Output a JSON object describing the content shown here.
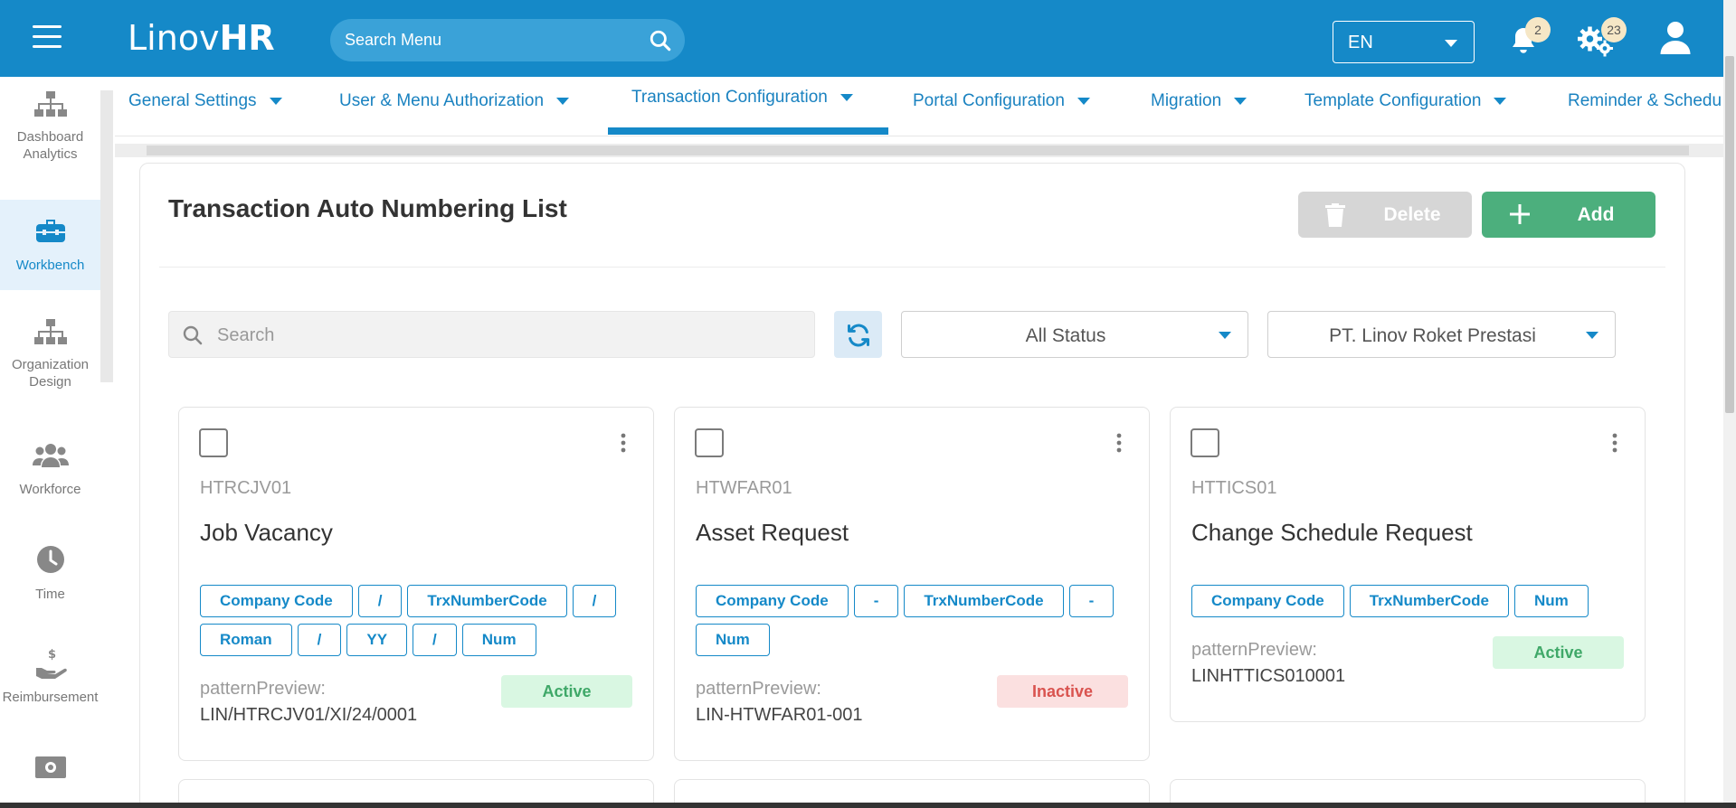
{
  "header": {
    "logo_part1": "Linov",
    "logo_part2": "HR",
    "search_placeholder": "Search Menu",
    "language": "EN",
    "notifications_count": "2",
    "settings_count": "23",
    "accent_color": "#1589c8"
  },
  "sidebar": {
    "items": [
      {
        "label_line1": "Dashboard",
        "label_line2": "Analytics",
        "icon": "sitemap-icon",
        "active": false
      },
      {
        "label_line1": "Workbench",
        "label_line2": "",
        "icon": "toolbox-icon",
        "active": true
      },
      {
        "label_line1": "Organization",
        "label_line2": "Design",
        "icon": "sitemap-icon",
        "active": false
      },
      {
        "label_line1": "Workforce",
        "label_line2": "",
        "icon": "users-icon",
        "active": false
      },
      {
        "label_line1": "Time",
        "label_line2": "",
        "icon": "clock-icon",
        "active": false
      },
      {
        "label_line1": "Reimbursement",
        "label_line2": "",
        "icon": "hand-dollar-icon",
        "active": false
      },
      {
        "label_line1": "",
        "label_line2": "",
        "icon": "money-icon",
        "active": false
      }
    ]
  },
  "tabs": [
    {
      "label": "General Settings"
    },
    {
      "label": "User & Menu Authorization"
    },
    {
      "label": "Transaction Configuration",
      "active": true
    },
    {
      "label": "Portal Configuration"
    },
    {
      "label": "Migration"
    },
    {
      "label": "Template Configuration"
    },
    {
      "label": "Reminder & Schedu"
    }
  ],
  "page": {
    "title": "Transaction Auto Numbering List",
    "delete_label": "Delete",
    "add_label": "Add",
    "search_placeholder": "Search",
    "status_filter": "All Status",
    "company_filter": "PT. Linov Roket Prestasi"
  },
  "cards": [
    {
      "code": "HTRCJV01",
      "title": "Job Vacancy",
      "chips": [
        "Company Code",
        "/",
        "TrxNumberCode",
        "/",
        "Roman",
        "/",
        "YY",
        "/",
        "Num"
      ],
      "pattern_label": "patternPreview:",
      "pattern_value": "LIN/HTRCJV01/XI/24/0001",
      "status": "Active"
    },
    {
      "code": "HTWFAR01",
      "title": "Asset Request",
      "chips": [
        "Company Code",
        "-",
        "TrxNumberCode",
        "-",
        "Num"
      ],
      "pattern_label": "patternPreview:",
      "pattern_value": "LIN-HTWFAR01-001",
      "status": "Inactive"
    },
    {
      "code": "HTTICS01",
      "title": "Change Schedule Request",
      "chips": [
        "Company Code",
        "TrxNumberCode",
        "Num"
      ],
      "pattern_label": "patternPreview:",
      "pattern_value": "LINHTTICS010001",
      "status": "Active"
    }
  ]
}
